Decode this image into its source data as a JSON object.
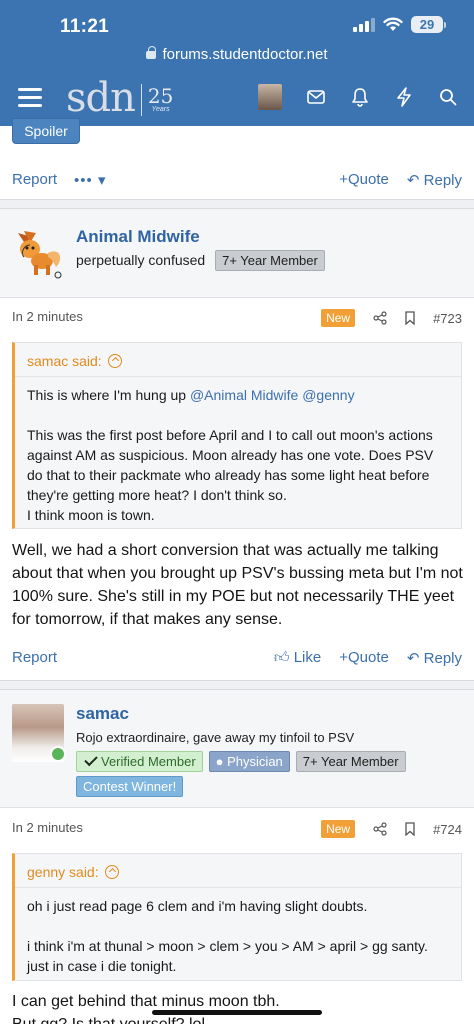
{
  "status": {
    "time": "11:21",
    "battery": "29"
  },
  "browser": {
    "url": "forums.studentdoctor.net"
  },
  "header": {
    "logo_text": "sdn",
    "logo_anniversary": "25",
    "logo_years": "Years"
  },
  "prev_post": {
    "spoiler_label": "Spoiler",
    "report_label": "Report",
    "more_label": "•••",
    "quote_label": "Quote",
    "reply_label": "Reply"
  },
  "posts": [
    {
      "username": "Animal Midwife",
      "user_title": "perpetually confused",
      "badges": [
        "7+ Year Member"
      ],
      "time": "In 2 minutes",
      "new_label": "New",
      "post_number": "#723",
      "quote": {
        "author": "samac said:",
        "line1_text": "This is where I'm hung up ",
        "line1_mentions": "@Animal Midwife @genny",
        "paragraph2": "This was the first post before April and I to call out moon's actions against AM as suspicious. Moon already has one vote. Does PSV do that to their packmate who already has some light heat before they're getting more heat? I don't think so.",
        "line3": "I think moon is town."
      },
      "body": "Well, we had a short conversion that was actually me talking about that when you brought up PSV's bussing meta but I'm not 100% sure. She's still in my POE but not necessarily THE yeet for tomorrow, if that makes any sense.",
      "report_label": "Report",
      "like_label": "Like",
      "quote_label": "Quote",
      "reply_label": "Reply"
    },
    {
      "username": "samac",
      "user_title": "Rojo extraordinaire, gave away my tinfoil to PSV",
      "badges": [
        "Verified Member",
        "Physician",
        "7+ Year Member",
        "Contest Winner!"
      ],
      "time": "In 2 minutes",
      "new_label": "New",
      "post_number": "#724",
      "quote": {
        "author": "genny said:",
        "paragraph1": "oh i just read page 6 clem and i'm having slight doubts.",
        "paragraph2": "i think i'm at thunal > moon > clem > you > AM > april > gg santy. just in case i die tonight."
      },
      "body_line1": "I can get behind that minus moon tbh.",
      "body_line2": "But gg? Is that yourself? lol"
    }
  ],
  "colors": {
    "header_blue": "#3b74b0",
    "link_blue": "#3c70ad",
    "quote_orange": "#f0a036"
  }
}
